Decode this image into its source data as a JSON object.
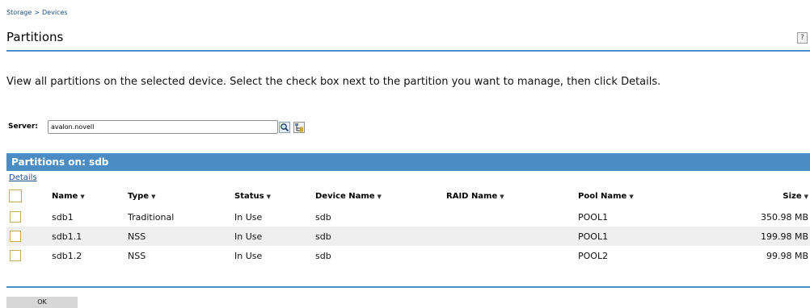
{
  "breadcrumb": [
    "Storage",
    "Devices"
  ],
  "breadcrumb_sep": ">",
  "page_title": "Partitions",
  "help_label": "?",
  "description": "View all partitions on the selected device. Select the check box next to the partition you want to manage, then click Details.",
  "server": {
    "label": "Server:",
    "value": "avalon.novell"
  },
  "icons": {
    "search": "search-icon",
    "browse": "browse-tree-icon",
    "help": "help-icon"
  },
  "table": {
    "title": "Partitions on: sdb",
    "details_link": "Details",
    "columns": [
      "Name",
      "Type",
      "Status",
      "Device Name",
      "RAID Name",
      "Pool Name",
      "Size"
    ],
    "rows": [
      [
        "sdb1",
        "Traditional",
        "In Use",
        "sdb",
        "",
        "POOL1",
        "350.98 MB"
      ],
      [
        "sdb1.1",
        "NSS",
        "In Use",
        "sdb",
        "",
        "POOL1",
        "199.98 MB"
      ],
      [
        "sdb1.2",
        "NSS",
        "In Use",
        "sdb",
        "",
        "POOL2",
        "99.98 MB"
      ]
    ]
  },
  "ok_label": "OK",
  "colors": {
    "accent": "#4a8cc3",
    "link": "#1b4e86",
    "checkbox_border": "#c8ac57",
    "row_stripe": "#efefef"
  }
}
